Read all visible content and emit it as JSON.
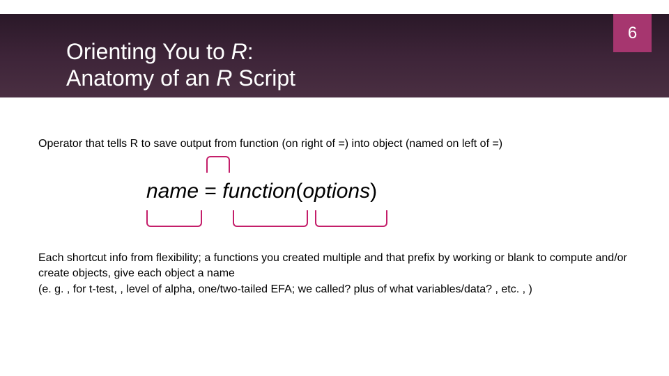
{
  "page_number": "6",
  "title_line1_a": "Orienting You to ",
  "title_line1_b": "R",
  "title_line1_c": ": ",
  "title_line2_a": "Anatomy of an ",
  "title_line2_b": "R",
  "title_line2_c": " Script",
  "operator_description": "Operator that tells R to save output from function (on right of =) into object (named on left of =)",
  "code_name": "name",
  "code_equals": " = ",
  "code_function": "function",
  "code_options_open": "(",
  "code_options": "options",
  "code_options_close": ")",
  "descriptions": {
    "name": "Each shortcut info from flexibility; a functions you created multiple and that prefix by working or blank to compute and/or create objects, give each object a name",
    "example": "(e. g. , for t-test, , level of alpha, one/two-tailed EFA; we called? plus of what variables/data? , etc. , )"
  }
}
